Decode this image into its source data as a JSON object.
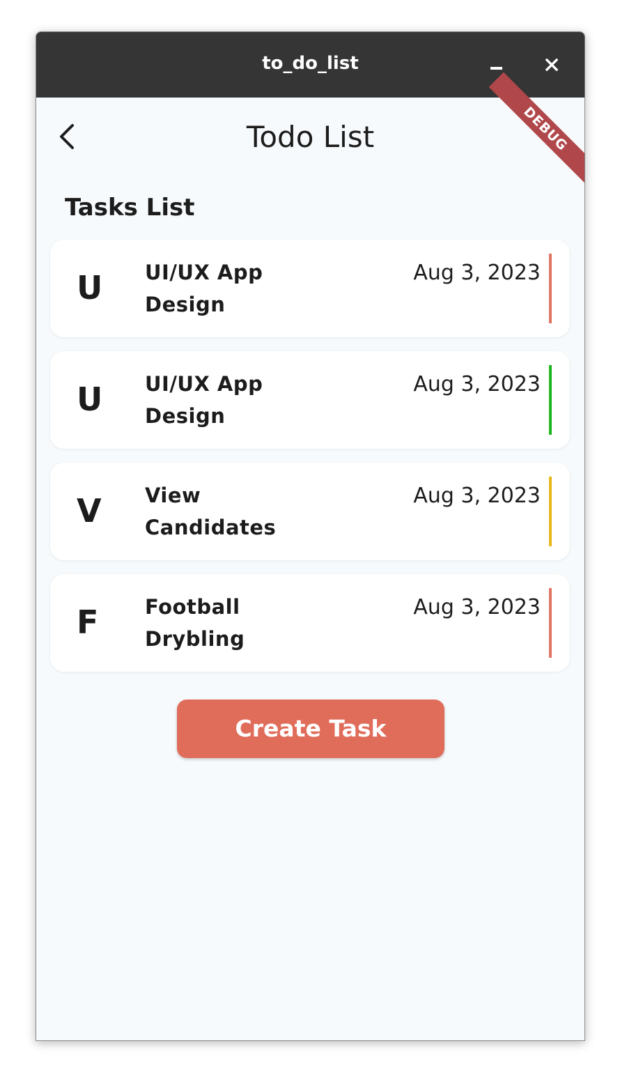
{
  "window": {
    "title": "to_do_list",
    "minimize_icon": "minimize-icon",
    "close_icon": "close-icon"
  },
  "header": {
    "back_icon": "chevron-left-icon",
    "title": "Todo List",
    "debug_banner": "DEBUG"
  },
  "section": {
    "title": "Tasks List"
  },
  "tasks": [
    {
      "initial": "U",
      "name_line1": "UI/UX App",
      "name_line2": "Design",
      "date": "Aug 3, 2023",
      "color": "#e07563"
    },
    {
      "initial": "U",
      "name_line1": "UI/UX App",
      "name_line2": "Design",
      "date": "Aug 3, 2023",
      "color": "#1fb51f"
    },
    {
      "initial": "V",
      "name_line1": "View",
      "name_line2": "Candidates",
      "date": "Aug 3, 2023",
      "color": "#e6b81b"
    },
    {
      "initial": "F",
      "name_line1": "Football",
      "name_line2": "Drybling",
      "date": "Aug 3, 2023",
      "color": "#e07563"
    }
  ],
  "actions": {
    "create_label": "Create Task",
    "create_color": "#e06c5a"
  }
}
